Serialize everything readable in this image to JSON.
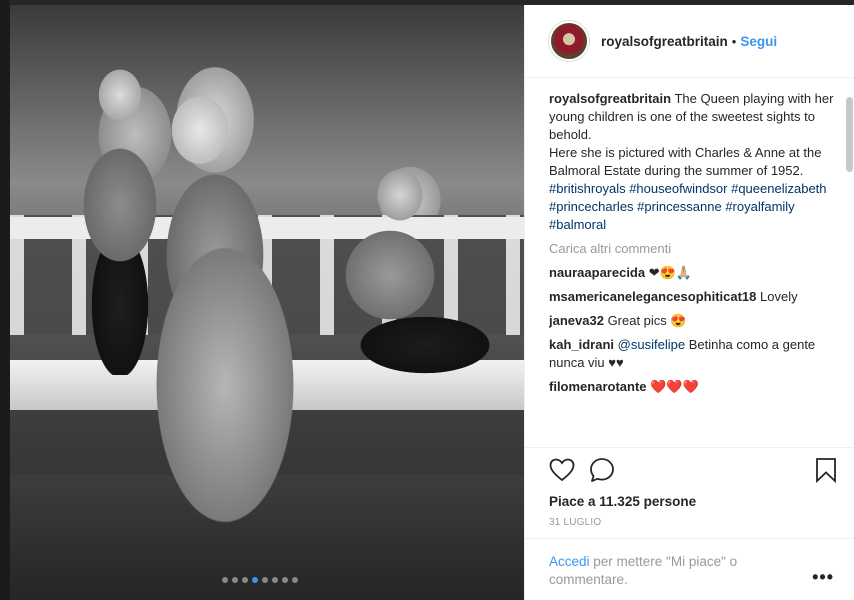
{
  "post": {
    "username": "royalsofgreatbritain",
    "follow_label": "Segui",
    "separator": "•",
    "caption": {
      "username": "royalsofgreatbritain",
      "text": "The Queen playing with her young children is one of the sweetest sights to behold.\nHere she is pictured with Charles & Anne at the Balmoral Estate during the summer of 1952.",
      "hashtags": "#britishroyals #houseofwindsor #queenelizabeth #princecharles #princessanne #royalfamily #balmoral"
    },
    "load_more_label": "Carica altri commenti",
    "comments": [
      {
        "user": "nauraaparecida",
        "text": "❤😍🙏🏼"
      },
      {
        "user": "msamericanelegancesophiticat18",
        "text": "Lovely"
      },
      {
        "user": "janeva32",
        "text": "Great pics 😍"
      },
      {
        "user": "kah_idrani",
        "mention": "@susifelipe",
        "text": "Betinha como a gente nunca viu ♥♥"
      },
      {
        "user": "filomenarotante",
        "text": "❤️❤️❤️"
      }
    ],
    "likes_label": "Piace a 11.325 persone",
    "date": "31 LUGLIO",
    "login_link": "Accedi",
    "login_text": " per mettere \"Mi piace\" o commentare.",
    "more_label": "•••",
    "carousel": {
      "count": 8,
      "active_index": 3
    }
  },
  "icons": [
    "heart-icon",
    "comment-icon",
    "bookmark-icon"
  ],
  "colors": {
    "accent": "#3897f0",
    "hashtag": "#003569",
    "muted": "#999999"
  }
}
